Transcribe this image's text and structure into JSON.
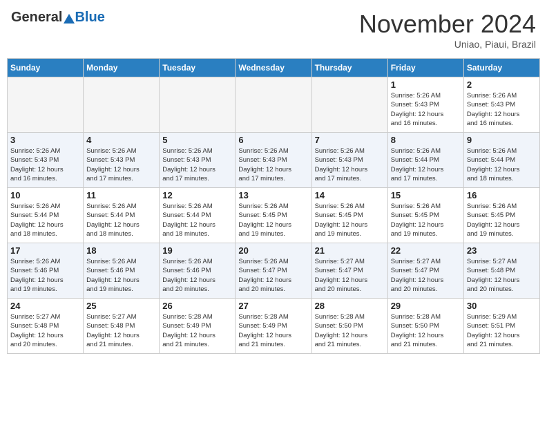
{
  "header": {
    "logo_general": "General",
    "logo_blue": "Blue",
    "month_title": "November 2024",
    "subtitle": "Uniao, Piaui, Brazil"
  },
  "weekdays": [
    "Sunday",
    "Monday",
    "Tuesday",
    "Wednesday",
    "Thursday",
    "Friday",
    "Saturday"
  ],
  "weeks": [
    [
      {
        "day": "",
        "info": ""
      },
      {
        "day": "",
        "info": ""
      },
      {
        "day": "",
        "info": ""
      },
      {
        "day": "",
        "info": ""
      },
      {
        "day": "",
        "info": ""
      },
      {
        "day": "1",
        "info": "Sunrise: 5:26 AM\nSunset: 5:43 PM\nDaylight: 12 hours\nand 16 minutes."
      },
      {
        "day": "2",
        "info": "Sunrise: 5:26 AM\nSunset: 5:43 PM\nDaylight: 12 hours\nand 16 minutes."
      }
    ],
    [
      {
        "day": "3",
        "info": "Sunrise: 5:26 AM\nSunset: 5:43 PM\nDaylight: 12 hours\nand 16 minutes."
      },
      {
        "day": "4",
        "info": "Sunrise: 5:26 AM\nSunset: 5:43 PM\nDaylight: 12 hours\nand 17 minutes."
      },
      {
        "day": "5",
        "info": "Sunrise: 5:26 AM\nSunset: 5:43 PM\nDaylight: 12 hours\nand 17 minutes."
      },
      {
        "day": "6",
        "info": "Sunrise: 5:26 AM\nSunset: 5:43 PM\nDaylight: 12 hours\nand 17 minutes."
      },
      {
        "day": "7",
        "info": "Sunrise: 5:26 AM\nSunset: 5:43 PM\nDaylight: 12 hours\nand 17 minutes."
      },
      {
        "day": "8",
        "info": "Sunrise: 5:26 AM\nSunset: 5:44 PM\nDaylight: 12 hours\nand 17 minutes."
      },
      {
        "day": "9",
        "info": "Sunrise: 5:26 AM\nSunset: 5:44 PM\nDaylight: 12 hours\nand 18 minutes."
      }
    ],
    [
      {
        "day": "10",
        "info": "Sunrise: 5:26 AM\nSunset: 5:44 PM\nDaylight: 12 hours\nand 18 minutes."
      },
      {
        "day": "11",
        "info": "Sunrise: 5:26 AM\nSunset: 5:44 PM\nDaylight: 12 hours\nand 18 minutes."
      },
      {
        "day": "12",
        "info": "Sunrise: 5:26 AM\nSunset: 5:44 PM\nDaylight: 12 hours\nand 18 minutes."
      },
      {
        "day": "13",
        "info": "Sunrise: 5:26 AM\nSunset: 5:45 PM\nDaylight: 12 hours\nand 19 minutes."
      },
      {
        "day": "14",
        "info": "Sunrise: 5:26 AM\nSunset: 5:45 PM\nDaylight: 12 hours\nand 19 minutes."
      },
      {
        "day": "15",
        "info": "Sunrise: 5:26 AM\nSunset: 5:45 PM\nDaylight: 12 hours\nand 19 minutes."
      },
      {
        "day": "16",
        "info": "Sunrise: 5:26 AM\nSunset: 5:45 PM\nDaylight: 12 hours\nand 19 minutes."
      }
    ],
    [
      {
        "day": "17",
        "info": "Sunrise: 5:26 AM\nSunset: 5:46 PM\nDaylight: 12 hours\nand 19 minutes."
      },
      {
        "day": "18",
        "info": "Sunrise: 5:26 AM\nSunset: 5:46 PM\nDaylight: 12 hours\nand 19 minutes."
      },
      {
        "day": "19",
        "info": "Sunrise: 5:26 AM\nSunset: 5:46 PM\nDaylight: 12 hours\nand 20 minutes."
      },
      {
        "day": "20",
        "info": "Sunrise: 5:26 AM\nSunset: 5:47 PM\nDaylight: 12 hours\nand 20 minutes."
      },
      {
        "day": "21",
        "info": "Sunrise: 5:27 AM\nSunset: 5:47 PM\nDaylight: 12 hours\nand 20 minutes."
      },
      {
        "day": "22",
        "info": "Sunrise: 5:27 AM\nSunset: 5:47 PM\nDaylight: 12 hours\nand 20 minutes."
      },
      {
        "day": "23",
        "info": "Sunrise: 5:27 AM\nSunset: 5:48 PM\nDaylight: 12 hours\nand 20 minutes."
      }
    ],
    [
      {
        "day": "24",
        "info": "Sunrise: 5:27 AM\nSunset: 5:48 PM\nDaylight: 12 hours\nand 20 minutes."
      },
      {
        "day": "25",
        "info": "Sunrise: 5:27 AM\nSunset: 5:48 PM\nDaylight: 12 hours\nand 21 minutes."
      },
      {
        "day": "26",
        "info": "Sunrise: 5:28 AM\nSunset: 5:49 PM\nDaylight: 12 hours\nand 21 minutes."
      },
      {
        "day": "27",
        "info": "Sunrise: 5:28 AM\nSunset: 5:49 PM\nDaylight: 12 hours\nand 21 minutes."
      },
      {
        "day": "28",
        "info": "Sunrise: 5:28 AM\nSunset: 5:50 PM\nDaylight: 12 hours\nand 21 minutes."
      },
      {
        "day": "29",
        "info": "Sunrise: 5:28 AM\nSunset: 5:50 PM\nDaylight: 12 hours\nand 21 minutes."
      },
      {
        "day": "30",
        "info": "Sunrise: 5:29 AM\nSunset: 5:51 PM\nDaylight: 12 hours\nand 21 minutes."
      }
    ]
  ]
}
